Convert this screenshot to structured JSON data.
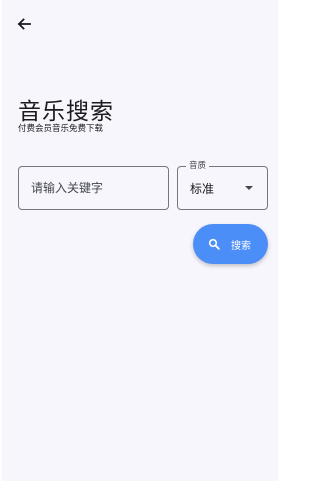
{
  "header": {
    "back_icon": "arrow-left-icon"
  },
  "page": {
    "title": "音乐搜索",
    "subtitle": "付费会员音乐免费下载"
  },
  "search": {
    "keyword_placeholder": "请输入关键字",
    "keyword_value": "",
    "quality_label": "音质",
    "quality_value": "标准",
    "button_label": "搜索",
    "button_icon": "search-icon"
  },
  "colors": {
    "background": "#f7f6fc",
    "accent": "#4c8ef7",
    "text": "#1b1b1f",
    "outline": "#76767c"
  }
}
